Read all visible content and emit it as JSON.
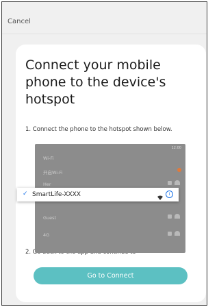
{
  "header": {
    "cancel_label": "Cancel"
  },
  "card": {
    "title": "Connect your mobile phone to the device's hotspot",
    "step1": "1. Connect the phone to the hotspot shown below.",
    "step2": "2. Go back to the app and continue to",
    "connect_button": "Go to Connect"
  },
  "phone_mock": {
    "status_time": "12:00",
    "rows": [
      "Wi-Fi",
      "开启Wi-Fi",
      "Her",
      "",
      "Guest",
      "4G"
    ],
    "selected_ssid": "SmartLife-XXXX"
  },
  "colors": {
    "accent": "#5cc0c2",
    "check": "#1a73e8"
  }
}
